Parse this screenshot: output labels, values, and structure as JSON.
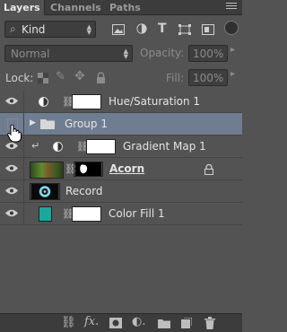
{
  "tabs": {
    "layers": "Layers",
    "channels": "Channels",
    "paths": "Paths"
  },
  "filter": {
    "kind_label": "Kind"
  },
  "blend": {
    "mode": "Normal",
    "opacity_label": "Opacity:",
    "opacity_value": "100%"
  },
  "lock": {
    "label": "Lock:",
    "fill_label": "Fill:",
    "fill_value": "100%"
  },
  "layers": [
    {
      "name": "Hue/Saturation 1"
    },
    {
      "name": "Group 1"
    },
    {
      "name": "Gradient Map 1"
    },
    {
      "name": "Acorn"
    },
    {
      "name": "Record"
    },
    {
      "name": "Color Fill 1"
    }
  ],
  "colors": {
    "fill_swatch": "#1aa89a",
    "selected_row": "#6f7d91"
  }
}
